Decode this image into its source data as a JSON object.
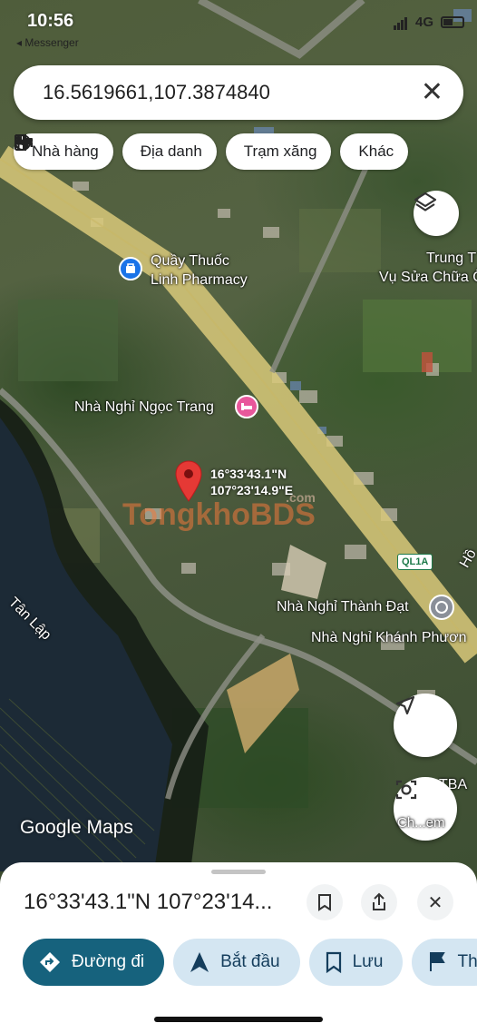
{
  "status_bar": {
    "time": "10:56",
    "back_app": "◂ Messenger",
    "network": "4G"
  },
  "search": {
    "value": "16.5619661,107.3874840"
  },
  "chips": [
    {
      "icon": "restaurant-icon",
      "label": "Nhà hàng"
    },
    {
      "icon": "landmark-icon",
      "label": "Địa danh"
    },
    {
      "icon": "gas-station-icon",
      "label": "Trạm xăng"
    },
    {
      "icon": "hotel-icon",
      "label": "Khác"
    }
  ],
  "map": {
    "places": {
      "pharmacy_line1": "Quầy Thuốc",
      "pharmacy_line2": "Linh Pharmacy",
      "guesthouse_ngoc_trang": "Nhà Nghỉ Ngọc Trang",
      "trung_tam_line1": "Trung T",
      "trung_tam_line2": "Vụ Sửa Chữa Ô",
      "thanh_dat": "Nhà Nghỉ Thành Đạt",
      "khanh_phuong": "Nhà Nghỉ Khánh Phươn",
      "tan_lap": "Tân Lập",
      "ho": "Hồ",
      "tba": "TBA",
      "ch_em": "Ch...em"
    },
    "pin_coords_line1": "16°33'43.1\"N",
    "pin_coords_line2": "107°23'14.9\"E",
    "road_badge": "QL1A",
    "watermark": "TongkhoBDS",
    "watermark_suffix": ".com",
    "attribution": "Google Maps"
  },
  "sheet": {
    "title": "16°33'43.1\"N 107°23'14...",
    "actions": [
      {
        "label": "Đường đi",
        "icon": "directions-icon"
      },
      {
        "label": "Bắt đầu",
        "icon": "navigate-icon"
      },
      {
        "label": "Lưu",
        "icon": "bookmark-icon"
      },
      {
        "label": "Th",
        "icon": "flag-icon"
      }
    ]
  },
  "colors": {
    "primary_button": "#16627d",
    "secondary_button": "#d4e6f2",
    "pin": "#e53935",
    "road": "#d9c97a"
  }
}
